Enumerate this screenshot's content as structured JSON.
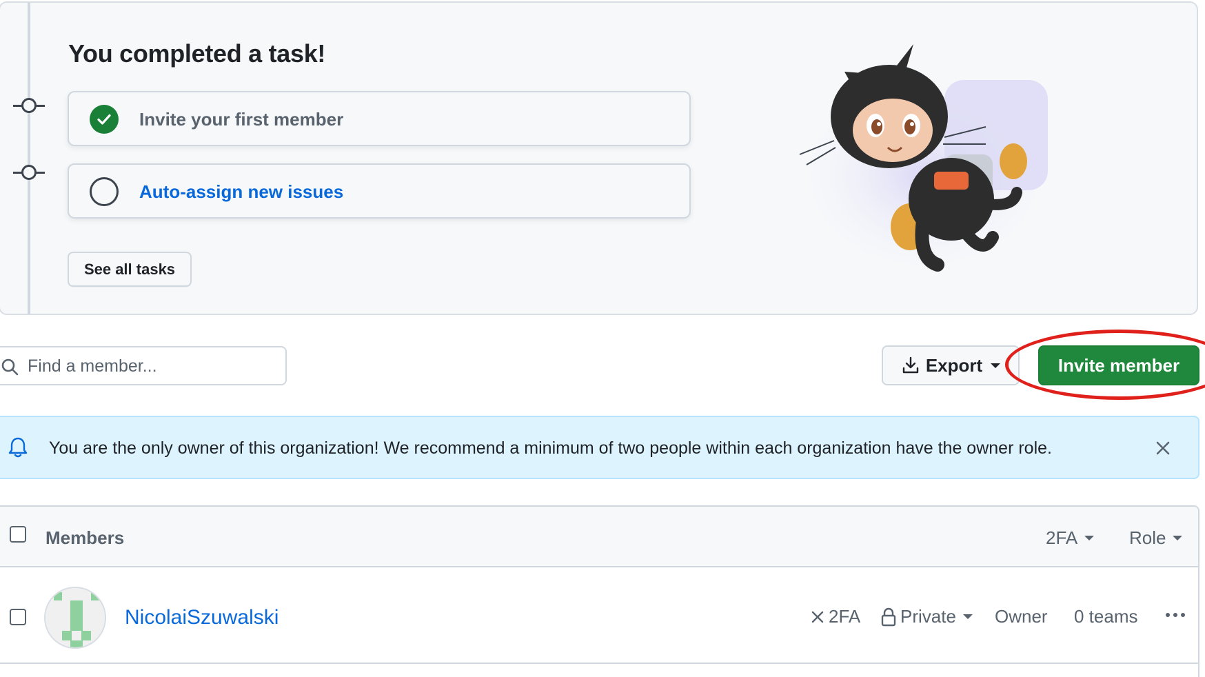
{
  "task_panel": {
    "title": "You completed a task!",
    "tasks": [
      {
        "label": "Invite your first member",
        "status": "completed"
      },
      {
        "label": "Auto-assign new issues",
        "status": "pending"
      }
    ],
    "see_all_label": "See all tasks",
    "illustration": "octocat-jetpack-illustration"
  },
  "toolbar": {
    "search_placeholder": "Find a member...",
    "export_label": "Export",
    "invite_label": "Invite member",
    "highlight_color": "#e0201b"
  },
  "banner": {
    "message": "You are the only owner of this organization! We recommend a minimum of two people within each organization have the owner role."
  },
  "members_table": {
    "header": {
      "title": "Members",
      "filter_2fa": "2FA",
      "filter_role": "Role"
    },
    "rows": [
      {
        "name": "NicolaiSzuwalski",
        "twofa": "2FA",
        "visibility": "Private",
        "role": "Owner",
        "teams": "0 teams"
      }
    ]
  },
  "colors": {
    "primary_button": "#1f883d",
    "link": "#0969da",
    "banner_bg": "#ddf4ff",
    "success": "#1a7f37"
  }
}
